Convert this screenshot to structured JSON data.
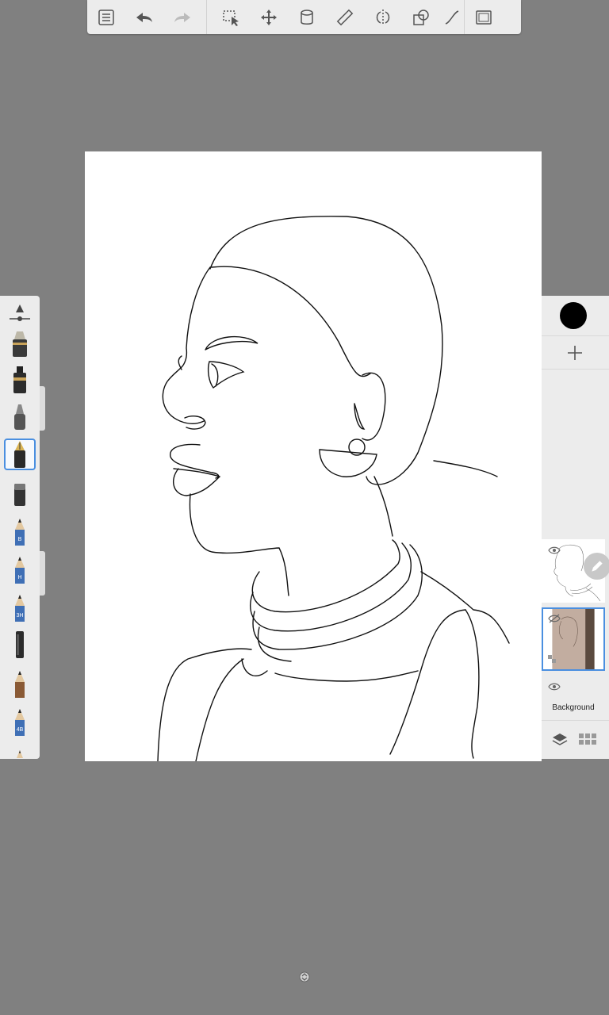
{
  "toolbar": {
    "buttons": [
      {
        "name": "menu-list-icon",
        "label": "Menu"
      },
      {
        "name": "undo-icon",
        "label": "Undo"
      },
      {
        "name": "redo-icon",
        "label": "Redo"
      },
      {
        "name": "selection-icon",
        "label": "Selection"
      },
      {
        "name": "transform-icon",
        "label": "Transform"
      },
      {
        "name": "fill-bucket-icon",
        "label": "Fill"
      },
      {
        "name": "ruler-icon",
        "label": "Ruler"
      },
      {
        "name": "symmetry-icon",
        "label": "Symmetry"
      },
      {
        "name": "shapes-icon",
        "label": "Shapes"
      },
      {
        "name": "stroke-icon",
        "label": "Stroke"
      },
      {
        "name": "fullscreen-icon",
        "label": "Full screen"
      }
    ]
  },
  "brushes": {
    "items": [
      {
        "name": "brush-size-slider-icon",
        "tag": ""
      },
      {
        "name": "marker-icon",
        "tag": ""
      },
      {
        "name": "ink-pen-icon",
        "tag": ""
      },
      {
        "name": "airbrush-icon",
        "tag": ""
      },
      {
        "name": "fountain-pen-icon",
        "tag": "",
        "selected": true
      },
      {
        "name": "eraser-icon",
        "tag": ""
      },
      {
        "name": "pencil-b-icon",
        "tag": "B"
      },
      {
        "name": "pencil-h-icon",
        "tag": "H"
      },
      {
        "name": "pencil-3h-icon",
        "tag": "3H"
      },
      {
        "name": "charcoal-icon",
        "tag": ""
      },
      {
        "name": "pencil-icon",
        "tag": ""
      },
      {
        "name": "pencil-4b-icon",
        "tag": "4B"
      }
    ]
  },
  "layers": {
    "color": "#000000",
    "background_label": "Background"
  },
  "colors": {
    "background": "#808080",
    "panel": "#ececec",
    "accent": "#4a8fe0"
  }
}
